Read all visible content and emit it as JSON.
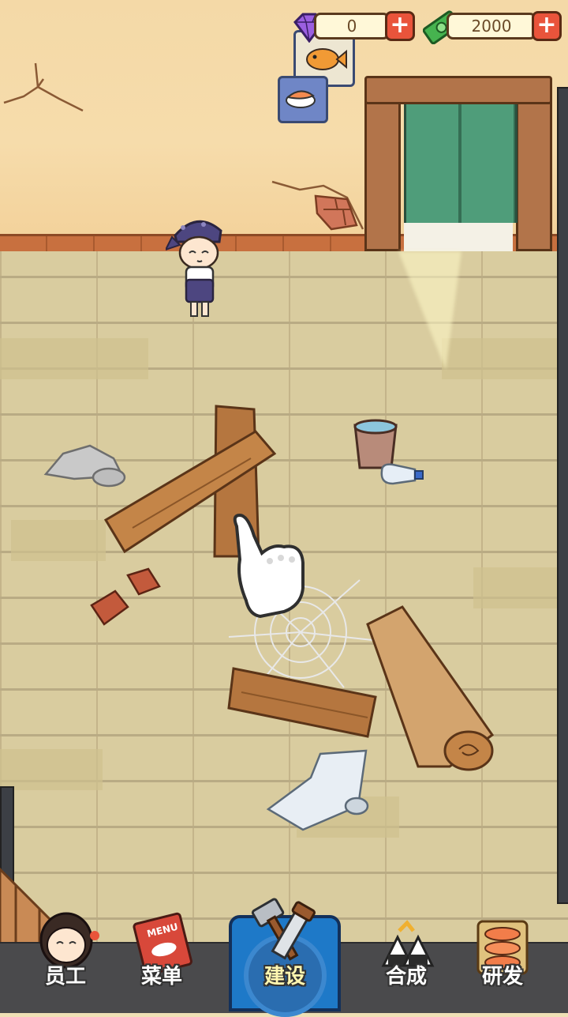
{
  "hud": {
    "gems": "0",
    "cash": "2000",
    "gem_icon": "purple-diamond-icon",
    "cash_icon": "green-banknote-icon",
    "add_icon": "plus-icon"
  },
  "nav": {
    "items": [
      {
        "id": "staff",
        "label": "员工",
        "icon": "waitress-face-icon"
      },
      {
        "id": "menu",
        "label": "菜单",
        "icon": "menu-book-icon",
        "icon_text": "MENU"
      },
      {
        "id": "build",
        "label": "建设",
        "icon": "hammer-saw-icon",
        "active": true
      },
      {
        "id": "merge",
        "label": "合成",
        "icon": "onigiri-merge-icon"
      },
      {
        "id": "research",
        "label": "研发",
        "icon": "sushi-stack-icon"
      }
    ]
  },
  "colors": {
    "active_tab": "#1e79c8",
    "nav_bar": "#4a4a4c",
    "wall": "#f6dcab",
    "floor": "#d9cc9f",
    "plus_button": "#e9543b"
  }
}
